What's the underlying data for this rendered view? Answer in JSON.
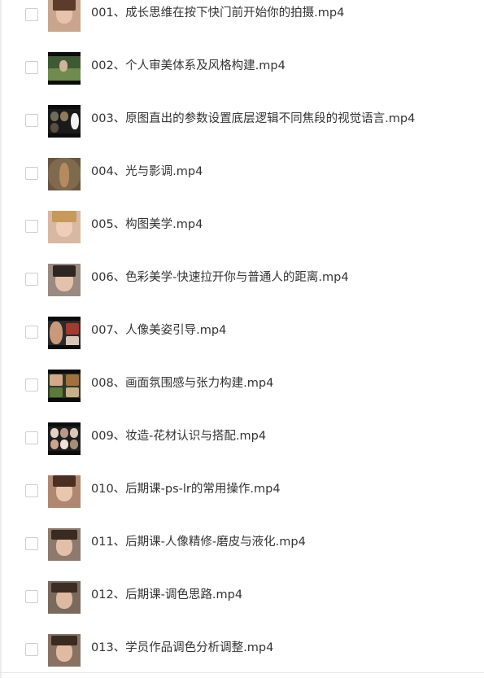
{
  "files": [
    {
      "name": "001、成长思维在按下快门前开始你的拍摄.mp4",
      "thumbnail": "woman-portrait-video-thumbnail"
    },
    {
      "name": "002、个人审美体系及风格构建.mp4",
      "thumbnail": "outdoor-scene-video-thumbnail"
    },
    {
      "name": "003、原图直出的参数设置底层逻辑不同焦段的视觉语言.mp4",
      "thumbnail": "slide-collage-video-thumbnail"
    },
    {
      "name": "004、光与影调.mp4",
      "thumbnail": "forest-portrait-video-thumbnail"
    },
    {
      "name": "005、构图美学.mp4",
      "thumbnail": "woman-portrait-video-thumbnail"
    },
    {
      "name": "006、色彩美学-快速拉开你与普通人的距离.mp4",
      "thumbnail": "woman-portrait-video-thumbnail"
    },
    {
      "name": "007、人像美姿引导.mp4",
      "thumbnail": "portrait-collage-video-thumbnail"
    },
    {
      "name": "008、画面氛围感与张力构建.mp4",
      "thumbnail": "portrait-collage-video-thumbnail"
    },
    {
      "name": "009、妆造-花材认识与搭配.mp4",
      "thumbnail": "portrait-grid-video-thumbnail"
    },
    {
      "name": "010、后期课-ps-lr的常用操作.mp4",
      "thumbnail": "woman-portrait-video-thumbnail"
    },
    {
      "name": "011、后期课-人像精修-磨皮与液化.mp4",
      "thumbnail": "woman-portrait-video-thumbnail"
    },
    {
      "name": "012、后期课-调色思路.mp4",
      "thumbnail": "woman-portrait-video-thumbnail"
    },
    {
      "name": "013、学员作品调色分析调整.mp4",
      "thumbnail": "woman-portrait-video-thumbnail"
    }
  ],
  "colors": {
    "text": "#333333",
    "checkbox_border": "#cfcfcf",
    "divider": "#ececec"
  }
}
